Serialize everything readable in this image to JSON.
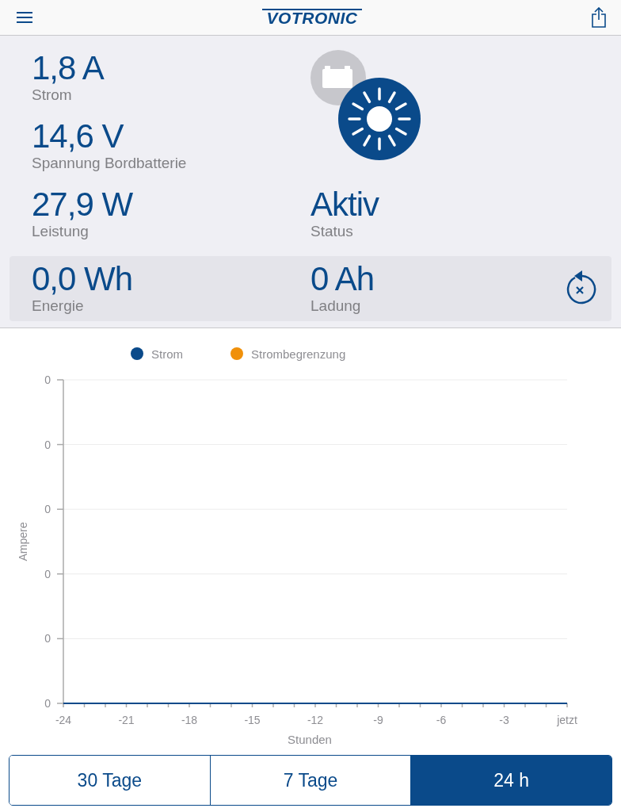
{
  "header": {
    "logo": "VOTRONIC"
  },
  "stats": [
    {
      "value": "1,8 A",
      "label": "Strom"
    },
    {
      "value": "14,6 V",
      "label": "Spannung Bordbatterie"
    },
    {
      "value": "27,9 W",
      "label": "Leistung"
    },
    {
      "value": "Aktiv",
      "label": "Status"
    }
  ],
  "totals": [
    {
      "value": "0,0 Wh",
      "label": "Energie"
    },
    {
      "value": "0 Ah",
      "label": "Ladung"
    }
  ],
  "chart": {
    "legend": [
      {
        "name": "Strom",
        "color": "#0a4a8a"
      },
      {
        "name": "Strombegrenzung",
        "color": "#f0900a"
      }
    ],
    "y_tick_labels": [
      "0",
      "0",
      "0",
      "0",
      "0",
      "0"
    ],
    "x_tick_labels": [
      "-24",
      "-21",
      "-18",
      "-15",
      "-12",
      "-9",
      "-6",
      "-3",
      "jetzt"
    ],
    "xlabel": "Stunden",
    "ylabel": "Ampere"
  },
  "ranges": [
    {
      "label": "30 Tage",
      "selected": false
    },
    {
      "label": "7 Tage",
      "selected": false
    },
    {
      "label": "24 h",
      "selected": true
    }
  ]
}
